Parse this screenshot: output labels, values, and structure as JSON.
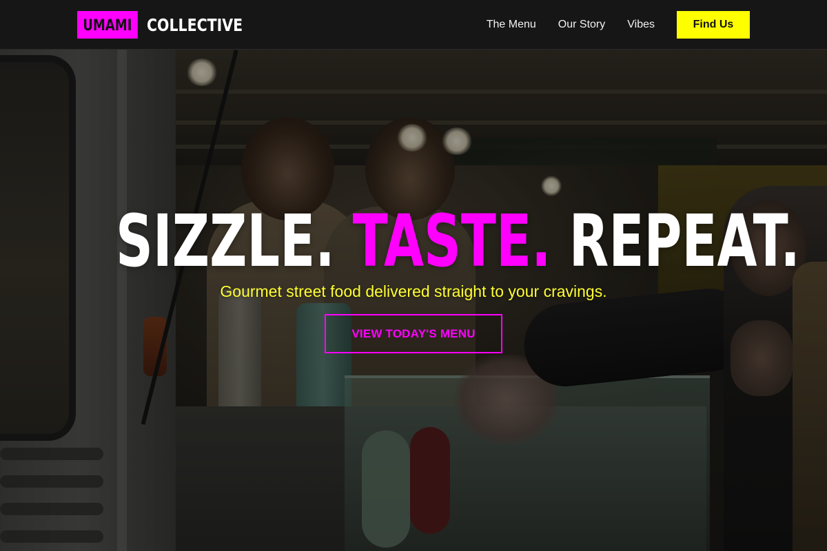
{
  "brand": {
    "box_text": "UMAMI",
    "text": "COLLECTIVE",
    "accent_color": "#ff00ff"
  },
  "nav": {
    "links": [
      "The Menu",
      "Our Story",
      "Vibes"
    ],
    "cta_label": "Find Us",
    "cta_color": "#ffff00"
  },
  "hero": {
    "headline": {
      "word1": "SIZZLE.",
      "word2": "TASTE.",
      "word3": "REPEAT."
    },
    "subtitle": "Gourmet street food delivered straight to your cravings.",
    "cta_label": "VIEW TODAY'S MENU",
    "background_image": "food-truck-photo"
  },
  "colors": {
    "magenta": "#ff00ff",
    "yellow": "#ffff00",
    "nav_bg": "#161616"
  }
}
